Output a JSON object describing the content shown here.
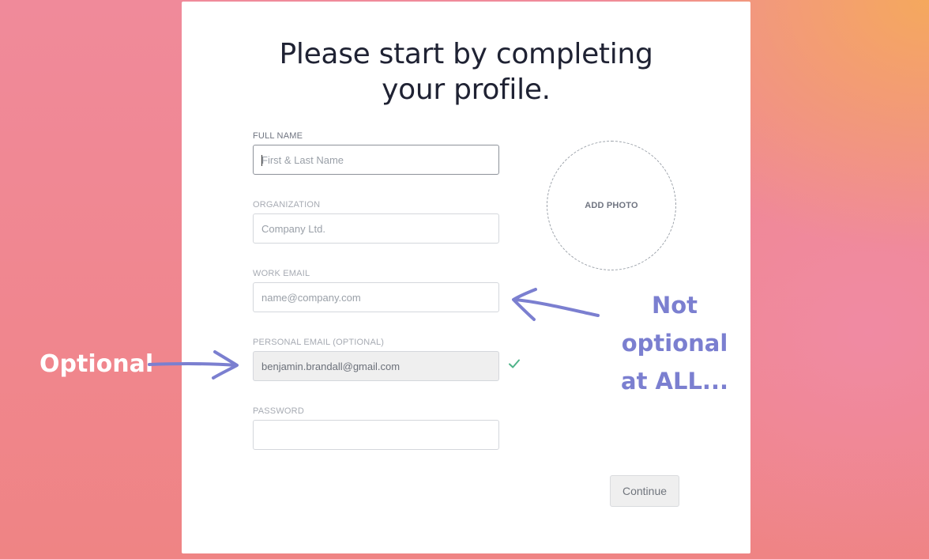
{
  "page": {
    "title_line1": "Please start by completing",
    "title_line2": "your profile."
  },
  "form": {
    "full_name": {
      "label": "FULL NAME",
      "placeholder": "First & Last Name",
      "value": ""
    },
    "organization": {
      "label": "ORGANIZATION",
      "placeholder": "Company Ltd.",
      "value": ""
    },
    "work_email": {
      "label": "WORK EMAIL",
      "placeholder": "name@company.com",
      "value": ""
    },
    "personal_email": {
      "label": "PERSONAL EMAIL (OPTIONAL)",
      "placeholder": "",
      "value": "benjamin.brandall@gmail.com",
      "valid": true
    },
    "password": {
      "label": "PASSWORD",
      "placeholder": "",
      "value": ""
    },
    "add_photo_label": "ADD PHOTO",
    "continue_label": "Continue"
  },
  "annotations": {
    "left": "Optional",
    "right_line1": "Not optional",
    "right_line2": "at ALL..."
  },
  "colors": {
    "annotation_left": "#ffffff",
    "annotation_right": "#7b7fd0",
    "arrow": "#7b7fd0",
    "check": "#4fb389",
    "title": "#1f2233"
  },
  "icons": {
    "check": "check-icon",
    "arrow_left": "hand-drawn-arrow-left-icon",
    "arrow_right": "hand-drawn-arrow-right-icon"
  }
}
